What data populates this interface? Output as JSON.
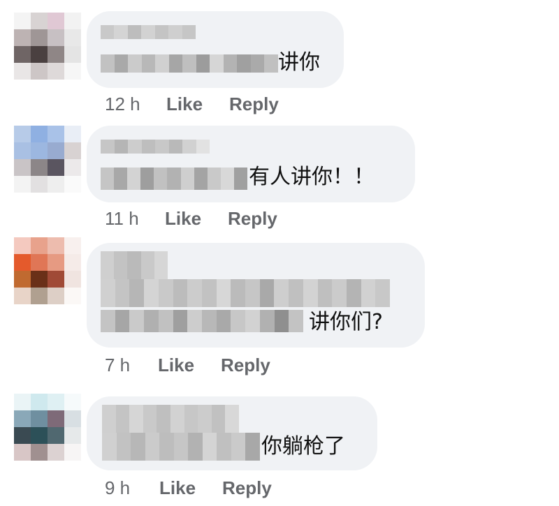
{
  "comments": [
    {
      "text": "讲你",
      "time": "12 h",
      "like": "Like",
      "reply": "Reply"
    },
    {
      "text": "有人讲你！！",
      "time": "11 h",
      "like": "Like",
      "reply": "Reply"
    },
    {
      "text": "讲你们?",
      "time": "7 h",
      "like": "Like",
      "reply": "Reply"
    },
    {
      "text": "你躺枪了",
      "time": "9 h",
      "like": "Like",
      "reply": "Reply"
    }
  ],
  "colors": {
    "bubble": "#f0f2f5",
    "meta": "#65676b",
    "text": "#111111"
  }
}
